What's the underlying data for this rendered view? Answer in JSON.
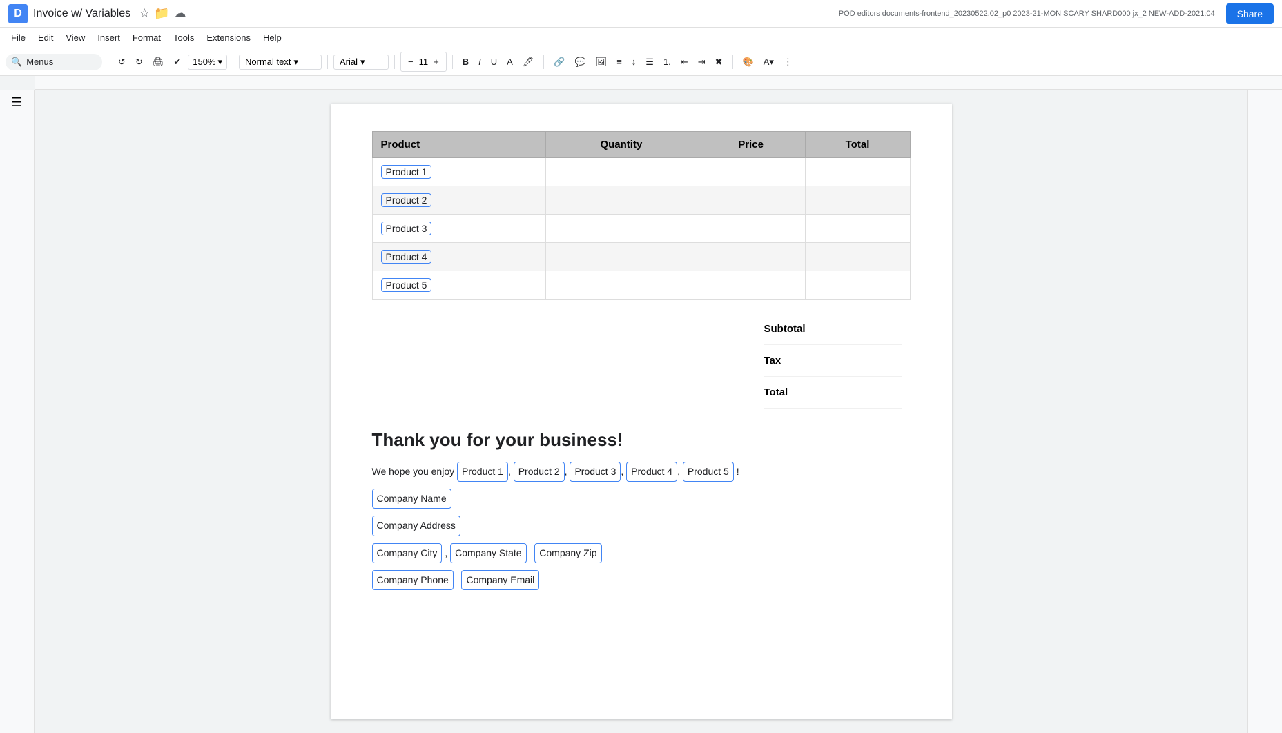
{
  "titlebar": {
    "doc_title": "Invoice w/ Variables",
    "share_label": "Share",
    "top_info": "POD editors documents-frontend_20230522.02_p0 2023-21-MON SCARY SHARD000 jx_2 NEW-ADD-2021:04"
  },
  "menubar": {
    "items": [
      "File",
      "Edit",
      "View",
      "Insert",
      "Format",
      "Tools",
      "Extensions",
      "Help"
    ]
  },
  "toolbar": {
    "menus_label": "Menus",
    "zoom": "150%",
    "style": "Normal text",
    "font": "Arial",
    "font_size": "11",
    "undo_label": "↺",
    "redo_label": "↻"
  },
  "table": {
    "headers": [
      "Product",
      "Quantity",
      "Price",
      "Total"
    ],
    "rows": [
      {
        "product": "Product 1",
        "quantity": "",
        "price": "",
        "total": ""
      },
      {
        "product": "Product 2",
        "quantity": "",
        "price": "",
        "total": ""
      },
      {
        "product": "Product 3",
        "quantity": "",
        "price": "",
        "total": ""
      },
      {
        "product": "Product 4",
        "quantity": "",
        "price": "",
        "total": ""
      },
      {
        "product": "Product 5",
        "quantity": "",
        "price": "",
        "total": ""
      }
    ]
  },
  "summary": {
    "subtotal_label": "Subtotal",
    "tax_label": "Tax",
    "total_label": "Total"
  },
  "thankyou": {
    "heading": "Thank you for your business!",
    "line1_prefix": "We hope you enjoy ",
    "products": [
      "Product 1",
      "Product 2",
      "Product 3",
      "Product 4",
      "Product 5"
    ],
    "line1_suffix": "!",
    "company_name": "Company Name",
    "company_address": "Company Address",
    "company_city": "Company City",
    "company_state": "Company State",
    "company_zip": "Company Zip",
    "company_phone": "Company Phone",
    "company_email": "Company Email"
  },
  "colors": {
    "chip_border": "#4285f4",
    "table_header_bg": "#c0c0c0",
    "accent": "#1a73e8"
  }
}
